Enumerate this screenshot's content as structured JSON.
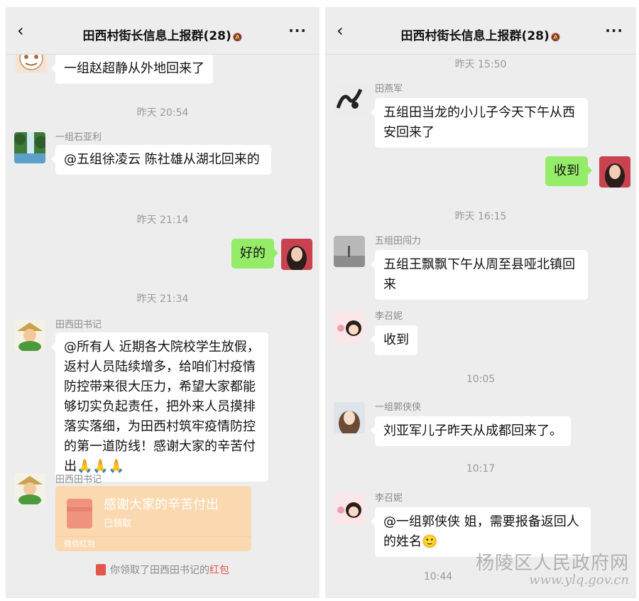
{
  "left": {
    "header": {
      "title": "田西村街长信息上报群(28)",
      "mute_icon": "bell-muted-icon"
    },
    "messages": [
      {
        "text": "一组赵超静从外地回来了"
      },
      {
        "time": "昨天 20:54",
        "name": "一组石亚利",
        "text": "@五组徐凌云 陈社雄从湖北回来的"
      },
      {
        "time": "昨天 21:14",
        "text": "好的"
      },
      {
        "time": "昨天 21:34",
        "name": "田西田书记",
        "text": "@所有人 近期各大院校学生放假，返村人员陆续增多，给咱们村疫情防控带来很大压力，希望大家都能够切实负起责任，把外来人员摸排落实落细，为田西村筑牢疫情防控的第一道防线！感谢大家的辛苦付出",
        "emoji": "🙏🙏🙏"
      }
    ],
    "red_packet": {
      "name": "田西田书记",
      "title": "感谢大家的辛苦付出",
      "status": "已领取",
      "footer": "微信红包"
    },
    "system_note": {
      "prefix": "你领取了田西田书记的",
      "highlight": "红包"
    }
  },
  "right": {
    "header": {
      "title": "田西村街长信息上报群(28)",
      "mute_icon": "bell-muted-icon"
    },
    "messages": [
      {
        "time": "昨天 15:50",
        "name": "田燕军",
        "text": "五组田当龙的小儿子今天下午从西安回来了"
      },
      {
        "text": "收到"
      },
      {
        "time": "昨天 16:15",
        "name": "五组田闯力",
        "text": "五组王飘飘下午从周至县哑北镇回来"
      },
      {
        "name": "李召妮",
        "text": "收到"
      },
      {
        "time": "10:05",
        "name": "一组郭侠侠",
        "text": "刘亚军儿子昨天从成都回来了。"
      },
      {
        "time": "10:17",
        "name": "李召妮",
        "text": "@一组郭侠侠 姐，需要报备返回人的姓名",
        "emoji": "🙂"
      },
      {
        "time": "10:44"
      }
    ]
  },
  "watermark": {
    "cn": "杨陵区人民政府网",
    "url": "www.ylq.gov.cn"
  }
}
